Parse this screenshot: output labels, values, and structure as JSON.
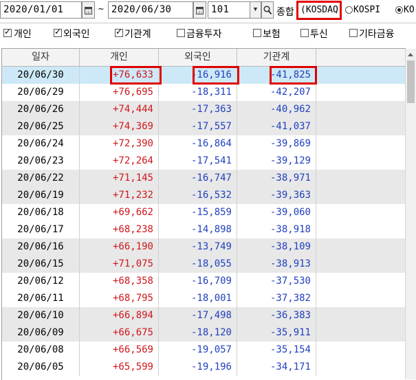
{
  "toolbar": {
    "start_date": "2020/01/01",
    "separator": "~",
    "end_date": "2020/06/30",
    "code": "101",
    "market_label": "종합",
    "market_selected": "(KOSDAQ",
    "radio_kospi": "KOSPI",
    "radio_kosdaq_partial": "KO"
  },
  "filters": [
    {
      "label": "개인",
      "checked": true
    },
    {
      "label": "외국인",
      "checked": true
    },
    {
      "label": "기관계",
      "checked": true
    },
    {
      "label": "금융투자",
      "checked": false
    },
    {
      "label": "보험",
      "checked": false
    },
    {
      "label": "투신",
      "checked": false
    },
    {
      "label": "기타금융",
      "checked": false
    }
  ],
  "table": {
    "headers": [
      "일자",
      "개인",
      "외국인",
      "기관계"
    ],
    "rows": [
      [
        "20/06/30",
        "+76,633",
        "-16,916",
        "-41,825"
      ],
      [
        "20/06/29",
        "+76,695",
        "-18,311",
        "-42,207"
      ],
      [
        "20/06/26",
        "+74,444",
        "-17,363",
        "-40,962"
      ],
      [
        "20/06/25",
        "+74,369",
        "-17,557",
        "-41,037"
      ],
      [
        "20/06/24",
        "+72,390",
        "-16,864",
        "-39,869"
      ],
      [
        "20/06/23",
        "+72,264",
        "-17,541",
        "-39,129"
      ],
      [
        "20/06/22",
        "+71,145",
        "-16,747",
        "-38,971"
      ],
      [
        "20/06/19",
        "+71,232",
        "-16,532",
        "-39,363"
      ],
      [
        "20/06/18",
        "+69,662",
        "-15,859",
        "-39,060"
      ],
      [
        "20/06/17",
        "+68,238",
        "-14,898",
        "-38,918"
      ],
      [
        "20/06/16",
        "+66,190",
        "-13,749",
        "-38,109"
      ],
      [
        "20/06/15",
        "+71,075",
        "-18,055",
        "-38,913"
      ],
      [
        "20/06/12",
        "+68,358",
        "-16,709",
        "-37,530"
      ],
      [
        "20/06/11",
        "+68,795",
        "-18,001",
        "-37,382"
      ],
      [
        "20/06/10",
        "+66,894",
        "-17,498",
        "-36,383"
      ],
      [
        "20/06/09",
        "+66,675",
        "-18,120",
        "-35,911"
      ],
      [
        "20/06/08",
        "+66,569",
        "-19,057",
        "-35,154"
      ],
      [
        "20/06/05",
        "+65,599",
        "-19,196",
        "-34,171"
      ]
    ]
  },
  "colors": {
    "positive": "#d0161b",
    "negative": "#1f3fbf",
    "highlight_box": "#e00000",
    "selected_row": "#cde9f7",
    "alt_row": "#e8e8e8"
  }
}
